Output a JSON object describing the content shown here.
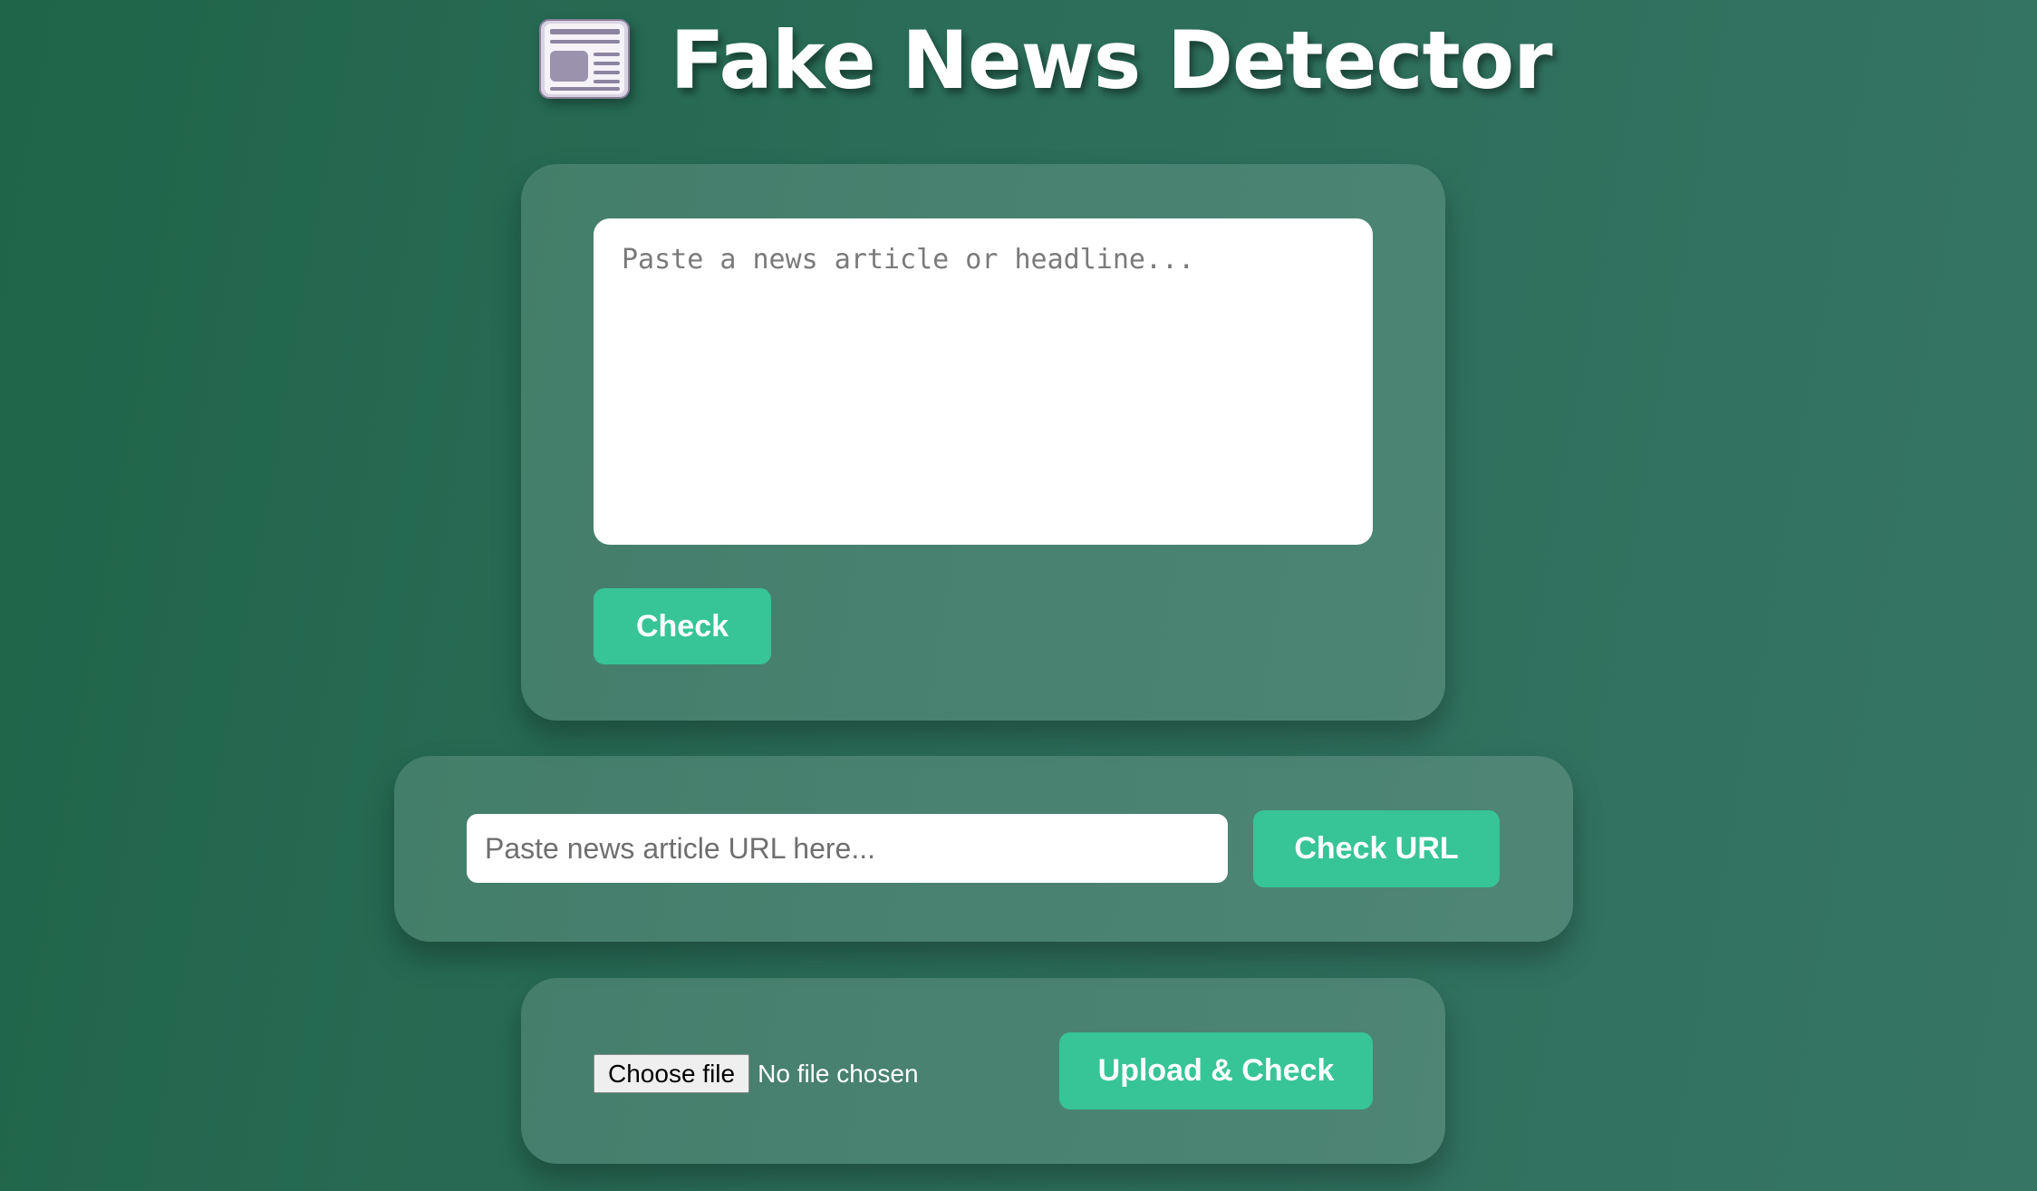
{
  "header": {
    "icon": "newspaper-icon",
    "title": "Fake News Detector"
  },
  "text_check": {
    "textarea_placeholder": "Paste a news article or headline...",
    "textarea_value": "",
    "check_label": "Check"
  },
  "url_check": {
    "input_placeholder": "Paste news article URL here...",
    "input_value": "",
    "check_url_label": "Check URL"
  },
  "file_check": {
    "choose_file_label": "Choose file",
    "file_status": "No file chosen",
    "upload_label": "Upload & Check"
  },
  "colors": {
    "background_start": "#1e6549",
    "background_end": "#367564",
    "accent_button": "#37c497",
    "text_white": "#ffffff"
  }
}
